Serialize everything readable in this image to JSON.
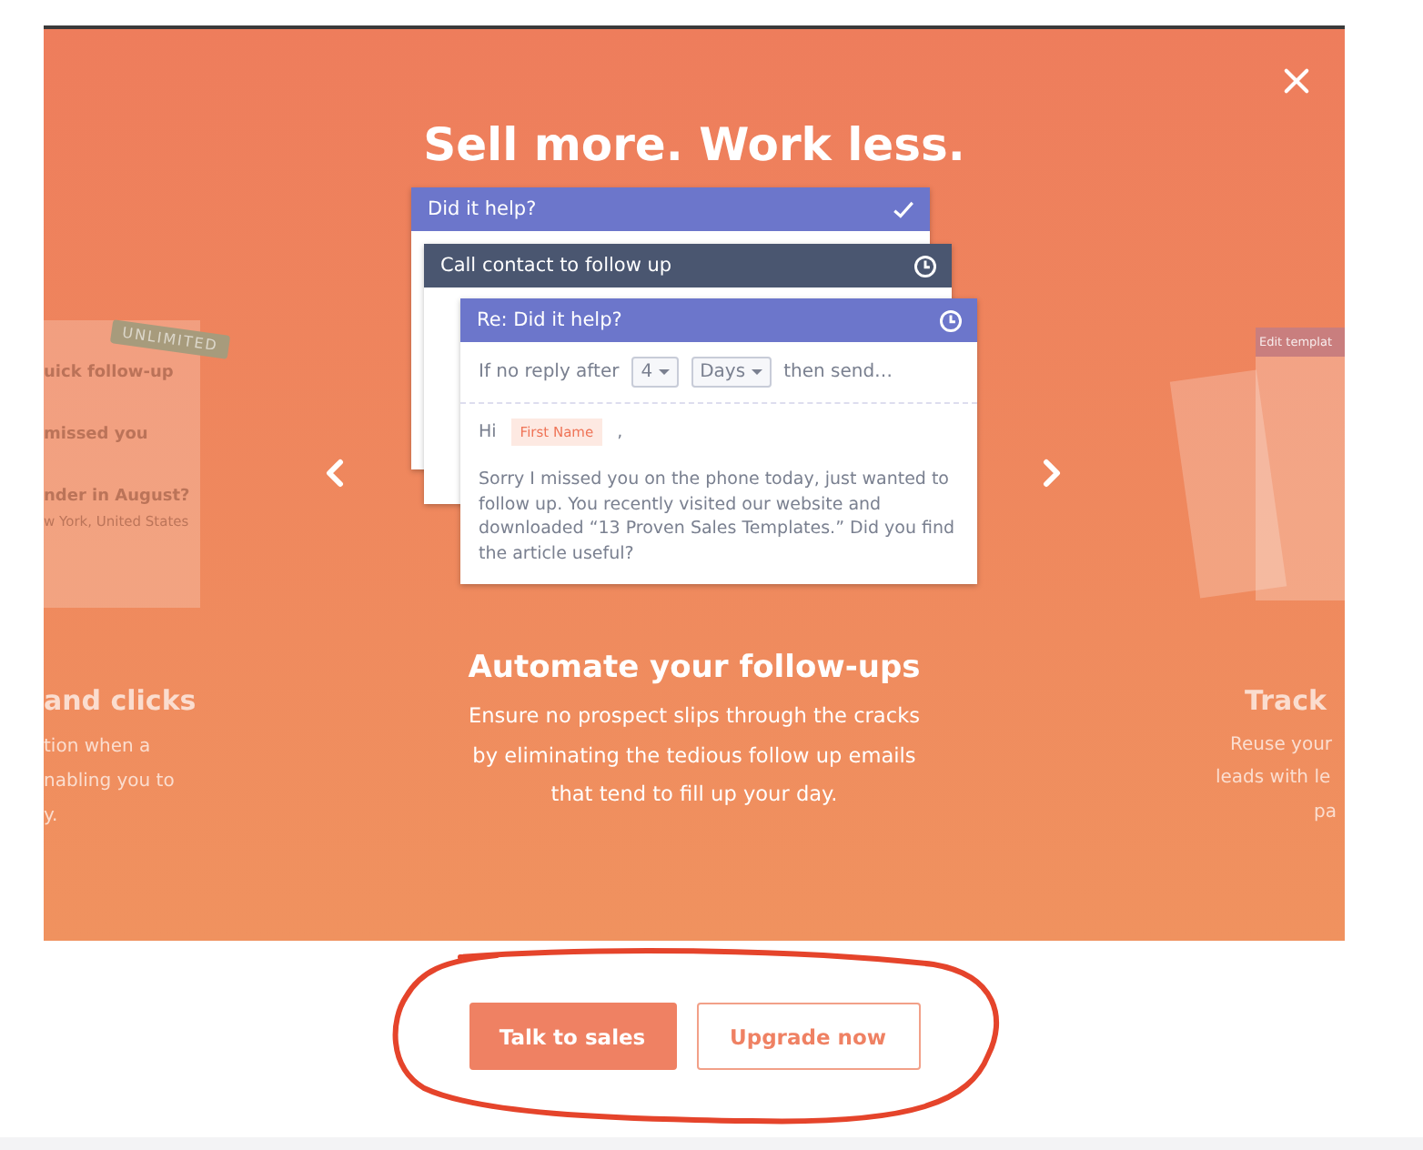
{
  "dialog": {
    "title": "Sell more. Work less."
  },
  "prev_slide": {
    "badge": "UNLIMITED",
    "items": [
      {
        "text": "uick follow-up",
        "kind": "title"
      },
      {
        "text": "missed you",
        "kind": "title"
      },
      {
        "text": "nder in August?",
        "kind": "title"
      },
      {
        "text": "w York, United States",
        "kind": "meta"
      }
    ],
    "heading": "and clicks",
    "lines": [
      "tion when a",
      "nabling you to",
      "y."
    ]
  },
  "current_slide": {
    "cards": [
      {
        "kind": "done",
        "title": "Did it help?"
      },
      {
        "kind": "task",
        "title": "Call contact to follow up"
      },
      {
        "kind": "email",
        "title": "Re: Did it help?",
        "rule": {
          "prefix": "If no reply after",
          "count": "4",
          "unit": "Days",
          "suffix": "then send…"
        },
        "greeting": "Hi",
        "token": "First Name",
        "comma": ",",
        "body": "Sorry I missed you on the phone today, just wanted to follow up. You recently visited our website and downloaded “13 Proven Sales Templates.” Did you find the article useful?"
      }
    ],
    "heading": "Automate your follow-ups",
    "lines": [
      "Ensure no prospect slips through the cracks",
      "by eliminating the tedious follow up emails",
      "that tend to fill up your day."
    ]
  },
  "next_slide": {
    "card_title": "Edit templat",
    "heading": "Track",
    "lines": [
      "Reuse your",
      "leads with le",
      "pa"
    ]
  },
  "buttons": [
    {
      "label": "Talk to sales",
      "kind": "primary"
    },
    {
      "label": "Upgrade now",
      "kind": "secondary"
    }
  ]
}
